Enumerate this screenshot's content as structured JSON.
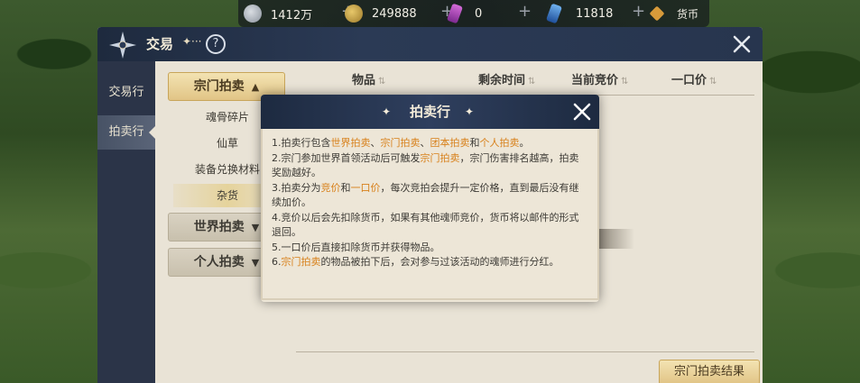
{
  "topbar": {
    "currencies": [
      {
        "icon": "silver-coin-icon",
        "value": "1412万"
      },
      {
        "icon": "gold-coin-icon",
        "value": "249888"
      },
      {
        "icon": "purple-crystal-icon",
        "value": "0"
      },
      {
        "icon": "blue-crystal-icon",
        "value": "11818"
      },
      {
        "icon": "hexagon-currency-icon",
        "value": "货币"
      }
    ]
  },
  "window": {
    "title": "交易",
    "dots": "✦···",
    "help": "?"
  },
  "leftnav": {
    "items": [
      {
        "label": "交易行"
      },
      {
        "label": "拍卖行"
      }
    ]
  },
  "categories": {
    "clan": {
      "label": "宗门拍卖",
      "arrow": "▲"
    },
    "subs": [
      "魂骨碎片",
      "仙草",
      "装备兑换材料",
      "杂货"
    ],
    "world": {
      "label": "世界拍卖",
      "arrow": "▼"
    },
    "personal": {
      "label": "个人拍卖",
      "arrow": "▼"
    }
  },
  "columns": {
    "item": "物品",
    "time": "剩余时间",
    "bid": "当前竞价",
    "buyout": "一口价",
    "sort": "⇅"
  },
  "result_button": "宗门拍卖结果",
  "modal": {
    "title": "拍卖行",
    "spark": "✦·✦",
    "lines": [
      [
        {
          "t": "1.拍卖行包含"
        },
        {
          "t": "世界拍卖",
          "h": true
        },
        {
          "t": "、"
        },
        {
          "t": "宗门拍卖",
          "h": true
        },
        {
          "t": "、"
        },
        {
          "t": "团本拍卖",
          "h": true
        },
        {
          "t": "和"
        },
        {
          "t": "个人拍卖",
          "h": true
        },
        {
          "t": "。"
        }
      ],
      [
        {
          "t": "2.宗门参加世界首领活动后可触发"
        },
        {
          "t": "宗门拍卖",
          "h": true
        },
        {
          "t": "，宗门伤害排名越高，拍卖奖励越好。"
        }
      ],
      [
        {
          "t": "3.拍卖分为"
        },
        {
          "t": "竞价",
          "h": true
        },
        {
          "t": "和"
        },
        {
          "t": "一口价",
          "h": true
        },
        {
          "t": "，每次竞拍会提升一定价格，直到最后没有继续加价。"
        }
      ],
      [
        {
          "t": "4.竞价以后会先扣除货币，如果有其他魂师竞价，货币将以邮件的形式退回。"
        }
      ],
      [
        {
          "t": "5.一口价后直接扣除货币并获得物品。"
        }
      ],
      [
        {
          "t": "6."
        },
        {
          "t": "宗门拍卖",
          "h": true
        },
        {
          "t": "的物品被拍下后，会对参与过该活动的魂师进行分红。"
        }
      ]
    ]
  },
  "colors": {
    "highlight": "#d8801a",
    "header_navy": "#1d2a40",
    "panel_bg": "#e9e3d6",
    "gold_button": "#e1c486"
  }
}
